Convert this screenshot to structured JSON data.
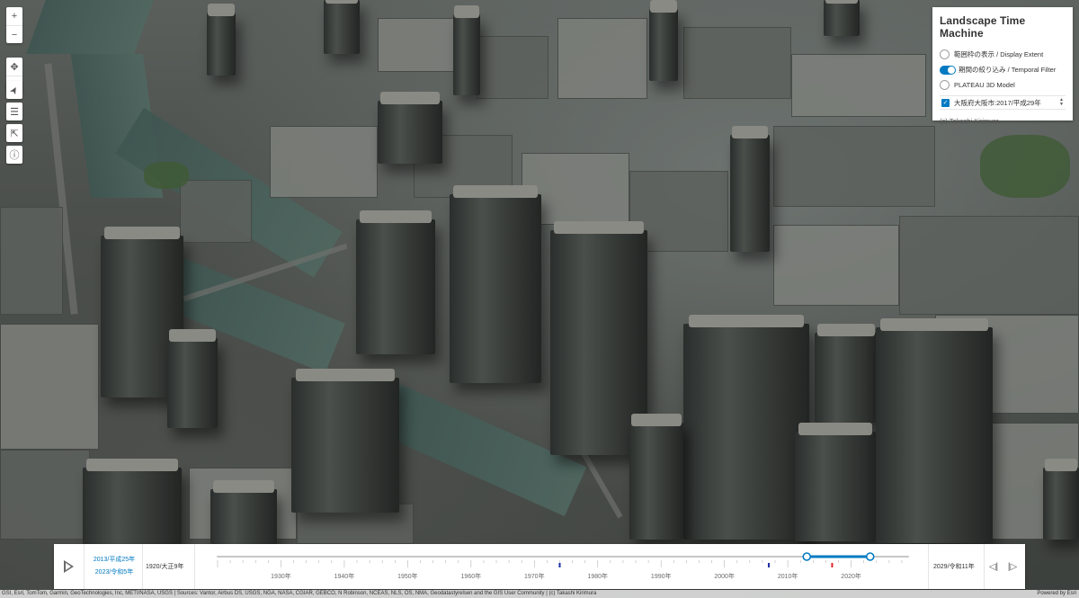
{
  "panel": {
    "title": "Landscape Time Machine",
    "options": [
      {
        "label": "範囲枠の表示 / Display Extent",
        "control": "radio",
        "checked": false
      },
      {
        "label": "期間の絞り込み / Temporal Filter",
        "control": "toggle",
        "checked": true
      },
      {
        "label": "PLATEAU 3D Model",
        "control": "radio",
        "checked": false
      }
    ],
    "layer_select": {
      "label": "大阪府大阪市:2017/平成29年",
      "checked": true
    },
    "credit": "(c) Takashi Kirimura"
  },
  "toolbar": {
    "zoom": [
      {
        "icon": "plus-icon",
        "glyph": "+"
      },
      {
        "icon": "minus-icon",
        "glyph": "−"
      }
    ],
    "tools": [
      {
        "icon": "pan-icon",
        "glyph": "✥"
      },
      {
        "icon": "rotate-icon",
        "glyph": "⟳"
      },
      {
        "icon": "compass-icon",
        "glyph": "➤"
      },
      {
        "icon": "layer-list-icon",
        "glyph": "☰"
      },
      {
        "icon": "share-icon",
        "glyph": "⇱"
      },
      {
        "icon": "info-icon",
        "glyph": "ⓘ"
      }
    ]
  },
  "time_slider": {
    "range_start": "2013/平成25年",
    "range_end": "2023/令和5年",
    "min_label": "1920/大正9年",
    "max_label": "2029/令和11年",
    "axis_min": 1920,
    "axis_max": 2029,
    "selected_from": 2013,
    "selected_to": 2023,
    "decade_labels": [
      "1930年",
      "1940年",
      "1950年",
      "1960年",
      "1970年",
      "1980年",
      "1990年",
      "2000年",
      "2010年",
      "2020年"
    ],
    "data_markers": [
      1974,
      2007
    ],
    "current_marker": 2017,
    "colors": {
      "accent": "#007ac2",
      "track": "#c7c7c7",
      "marker": "#1a2fa8",
      "current": "#e32323"
    }
  },
  "attribution": {
    "text": "GSI, Esri, TomTom, Garmin, GeoTechnologies, Inc, METI/NASA, USGS | Sources: Vantor, Airbus DS, USGS, NGA, NASA, CGIAR, GEBCO, N Robinson, NCEAS, NLS, OS, NMA, Geodatastyrelsen and the GIS User Community | (c) Takashi Kirimura",
    "powered_by": "Powered by Esri"
  }
}
